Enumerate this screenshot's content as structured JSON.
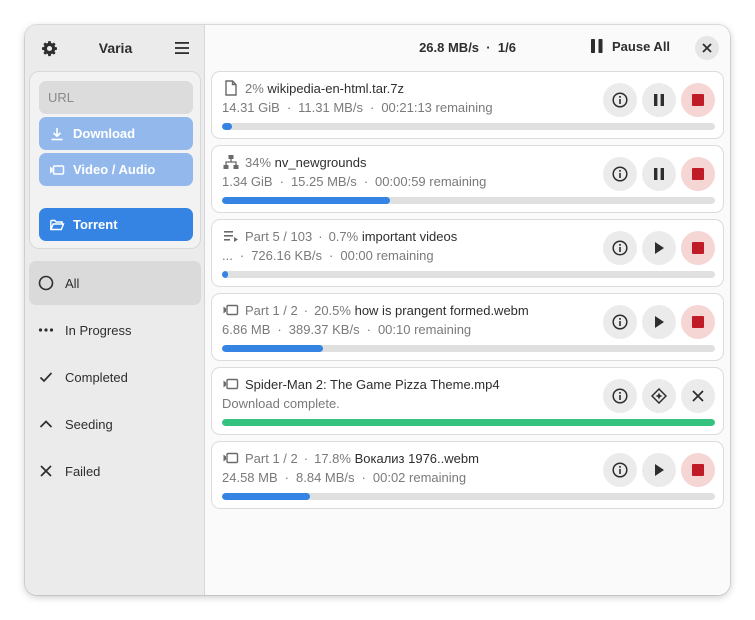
{
  "sidebar": {
    "title": "Varia",
    "url_placeholder": "URL",
    "download_label": "Download",
    "video_audio_label": "Video / Audio",
    "torrent_label": "Torrent",
    "filters": [
      {
        "label": "All",
        "icon": "circle-icon"
      },
      {
        "label": "In Progress",
        "icon": "dots-icon"
      },
      {
        "label": "Completed",
        "icon": "check-icon"
      },
      {
        "label": "Seeding",
        "icon": "chevron-up-icon"
      },
      {
        "label": "Failed",
        "icon": "x-icon"
      }
    ]
  },
  "header": {
    "speed": "26.8 MB/s",
    "count": "1/6",
    "pause_all_label": "Pause All"
  },
  "colors": {
    "accent": "#3584e4",
    "accent_dim": "#93b9ec",
    "complete": "#33c27f",
    "stop": "#c01c28",
    "stop_bg": "#f6d5d5"
  },
  "downloads": [
    {
      "type_icon": "file-icon",
      "prefix": "",
      "percent": "2%",
      "name": "wikipedia-en-html.tar.7z",
      "size": "14.31 GiB",
      "speed": "11.31  MB/s",
      "remaining": "00:21:13 remaining",
      "progress": 0.02,
      "state": "active"
    },
    {
      "type_icon": "network-icon",
      "prefix": "",
      "percent": "34%",
      "name": "nv_newgrounds",
      "size": "1.34 GiB",
      "speed": "15.25  MB/s",
      "remaining": "00:00:59 remaining",
      "progress": 0.34,
      "state": "active"
    },
    {
      "type_icon": "playlist-icon",
      "prefix": "Part 5 / 103",
      "percent": "0.7%",
      "name": "important videos",
      "size": "...",
      "speed": "726.16 KB/s",
      "remaining": "00:00 remaining",
      "progress": 0.007,
      "state": "paused"
    },
    {
      "type_icon": "video-icon",
      "prefix": "Part 1 / 2",
      "percent": "20.5%",
      "name": "how is prangent formed.webm",
      "size": "6.86 MB",
      "speed": "389.37 KB/s",
      "remaining": "00:10 remaining",
      "progress": 0.205,
      "state": "paused"
    },
    {
      "type_icon": "video-icon",
      "prefix": "",
      "percent": "",
      "name": "Spider-Man 2: The Game Pizza Theme.mp4",
      "status": "Download complete.",
      "progress": 1.0,
      "state": "complete"
    },
    {
      "type_icon": "video-icon",
      "prefix": "Part 1 / 2",
      "percent": "17.8%",
      "name": "Вокализ 1976..webm",
      "size": "24.58 MB",
      "speed": "8.84 MB/s",
      "remaining": "00:02 remaining",
      "progress": 0.178,
      "state": "paused"
    }
  ]
}
